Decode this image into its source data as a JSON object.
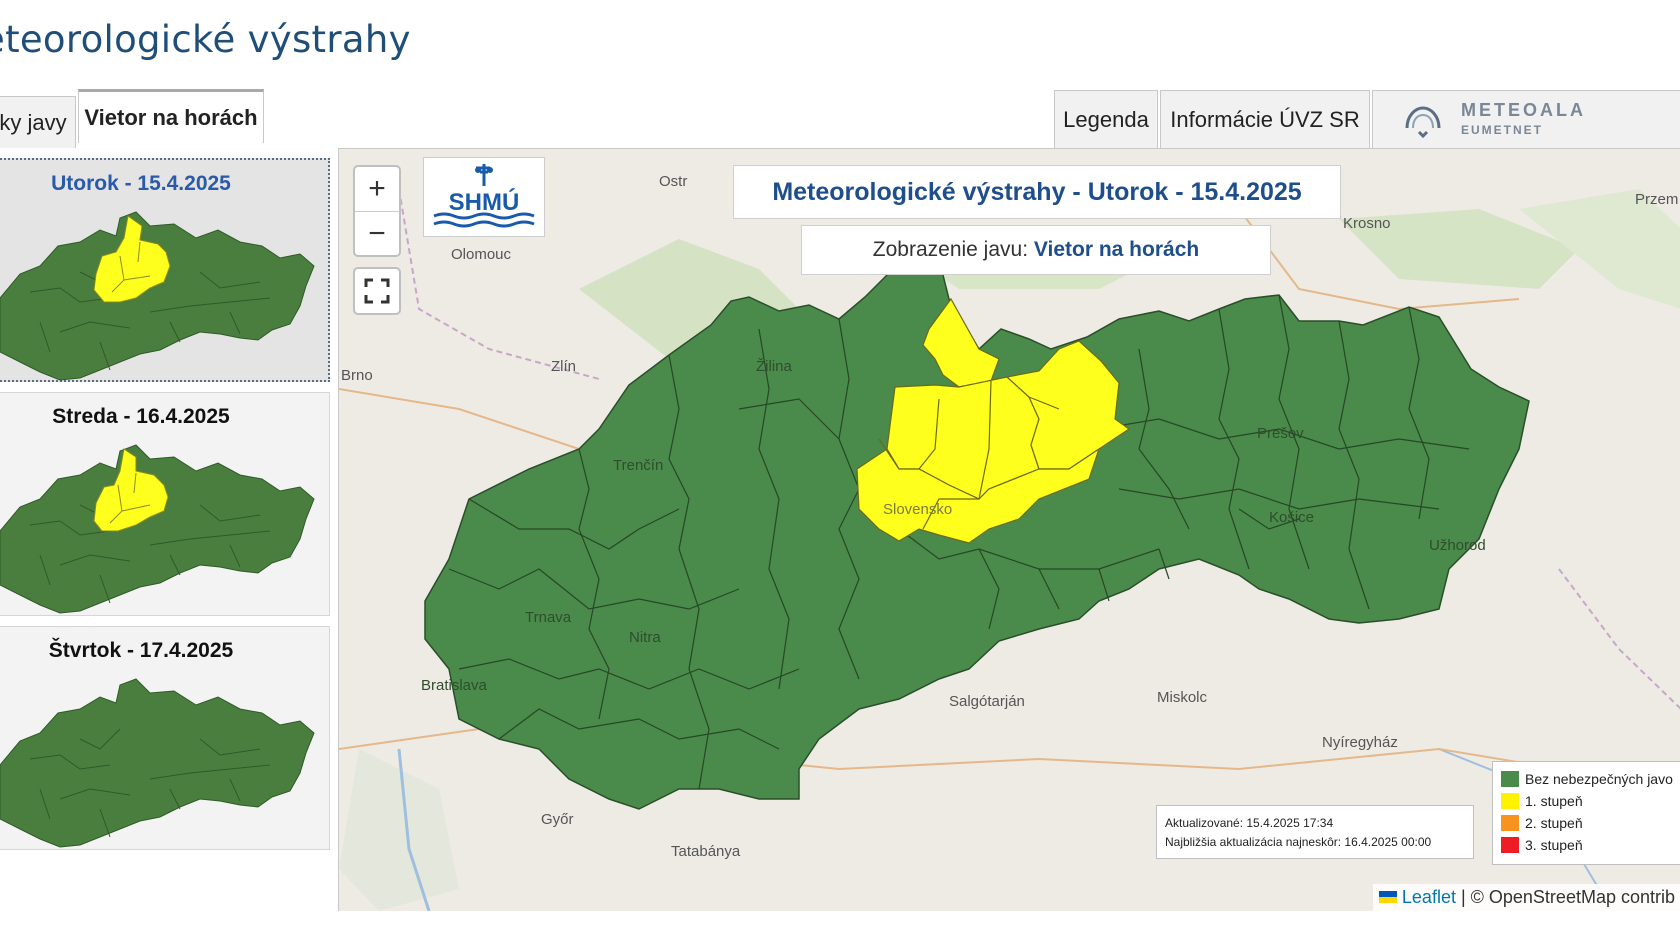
{
  "page_title": "eteorologické výstrahy",
  "tabs": [
    {
      "label": "ky javy"
    },
    {
      "label": "Vietor na horách"
    }
  ],
  "right_tabs": {
    "legend": "Legenda",
    "info": "Informácie ÚVZ SR",
    "meteoalarm_top": "METEOALA",
    "meteoalarm_bottom": "EUMETNET"
  },
  "days": [
    {
      "label": "Utorok - 15.4.2025"
    },
    {
      "label": "Streda - 16.4.2025"
    },
    {
      "label": "Štvrtok - 17.4.2025"
    }
  ],
  "map": {
    "title": "Meteorologické výstrahy - Utorok - 15.4.2025",
    "subtitle_prefix": "Zobrazenie javu: ",
    "subtitle_value": "Vietor na horách",
    "logo_text": "SHMÚ",
    "zoom_in": "+",
    "zoom_out": "−",
    "updated": "Aktualizované: 15.4.2025 17:34",
    "next_update": "Najbližšia aktualizácia najneskôr: 16.4.2025 00:00",
    "legend": [
      {
        "label": "Bez nebezpečných javo",
        "color": "#4a8a4a"
      },
      {
        "label": "1. stupeň",
        "color": "#fff200"
      },
      {
        "label": "2. stupeň",
        "color": "#f7931e"
      },
      {
        "label": "3. stupeň",
        "color": "#ee1c25"
      }
    ],
    "attribution_leaflet": "Leaflet",
    "attribution_rest": " | © OpenStreetMap contrib",
    "cities": [
      {
        "name": "Olomouc"
      },
      {
        "name": "Brno"
      },
      {
        "name": "Zlín"
      },
      {
        "name": "Žilina"
      },
      {
        "name": "Trenčín"
      },
      {
        "name": "Trnava"
      },
      {
        "name": "Nitra"
      },
      {
        "name": "Bratislava"
      },
      {
        "name": "Győr"
      },
      {
        "name": "Salgótarján"
      },
      {
        "name": "Miskolc"
      },
      {
        "name": "Nyíregyház"
      },
      {
        "name": "Prešov"
      },
      {
        "name": "Košice"
      },
      {
        "name": "Užhorod"
      },
      {
        "name": "Krosno"
      },
      {
        "name": "Slovensko"
      },
      {
        "name": "Ostr"
      },
      {
        "name": "Przem"
      },
      {
        "name": "Tatabánya"
      }
    ]
  },
  "colors": {
    "green": "#4a8a4a",
    "yellow": "#fff200",
    "title_blue": "#1f4e8c"
  }
}
